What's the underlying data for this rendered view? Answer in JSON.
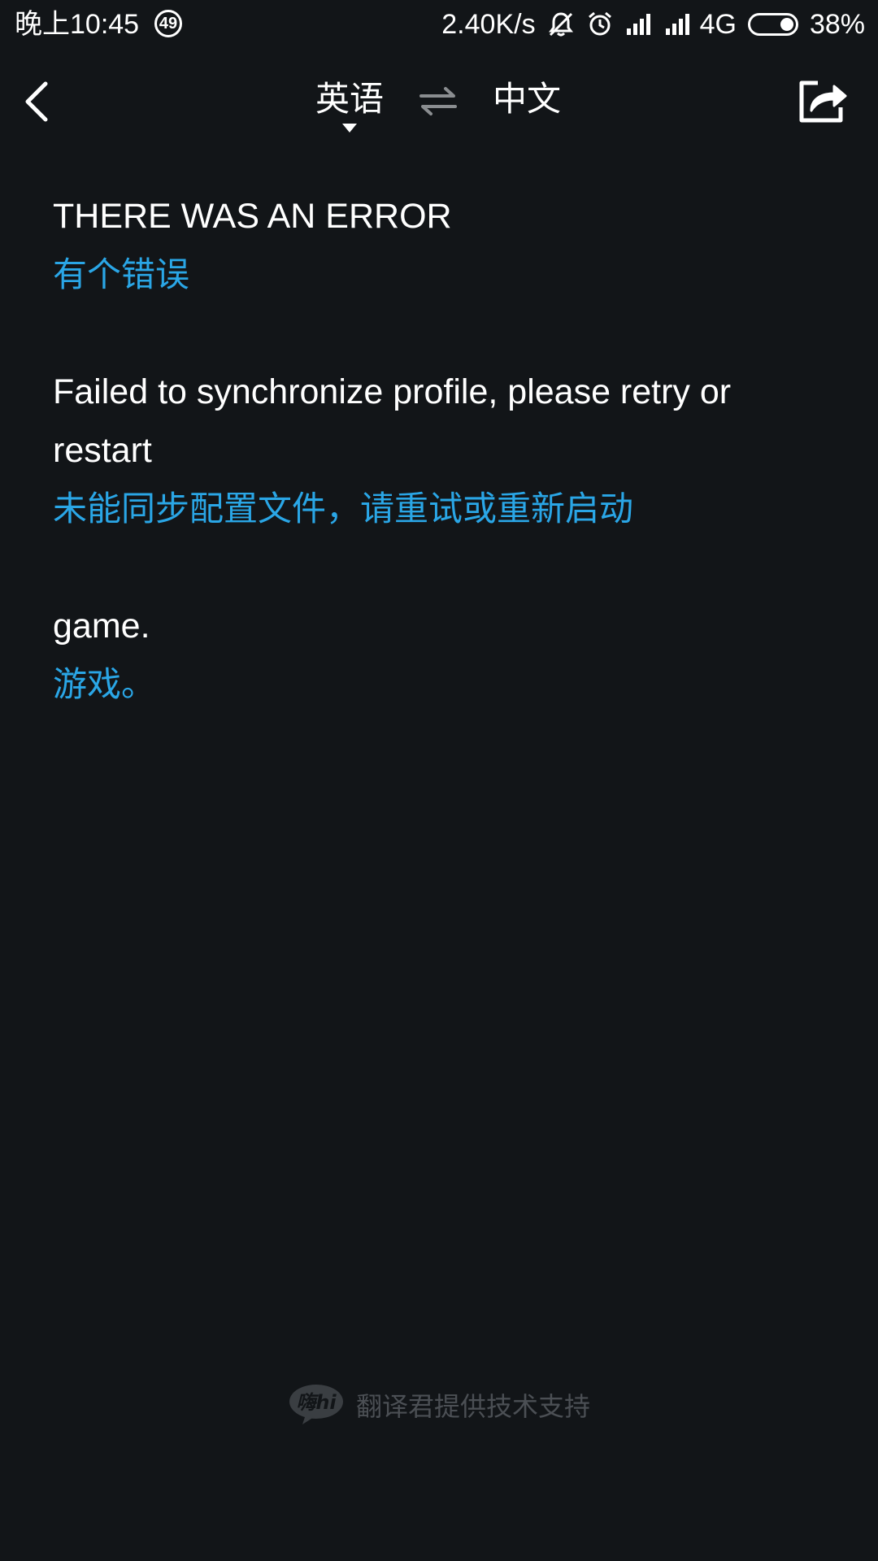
{
  "status_bar": {
    "time": "晚上10:45",
    "notification_count": "49",
    "net_speed": "2.40K/s",
    "network_type": "4G",
    "battery_percent": "38%"
  },
  "nav": {
    "back_icon": "chevron-left-icon",
    "source_language": "英语",
    "swap_icon": "swap-arrows-icon",
    "target_language": "中文",
    "share_icon": "share-icon"
  },
  "translations": [
    {
      "source": "THERE WAS AN ERROR",
      "target": "有个错误"
    },
    {
      "source": "Failed to synchronize profile, please retry or restart",
      "target": "未能同步配置文件，请重试或重新启动"
    },
    {
      "source": "game.",
      "target": "游戏。"
    }
  ],
  "footer": {
    "logo_text": "嗨hi",
    "text": "翻译君提供技术支持"
  },
  "colors": {
    "background": "#121518",
    "translated_text": "#2aa6e6",
    "footer_text": "#4b4f54"
  }
}
